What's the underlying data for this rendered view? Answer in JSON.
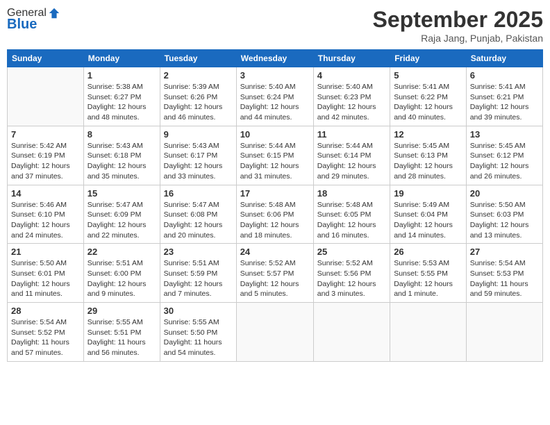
{
  "logo": {
    "general": "General",
    "blue": "Blue"
  },
  "header": {
    "month": "September 2025",
    "location": "Raja Jang, Punjab, Pakistan"
  },
  "weekdays": [
    "Sunday",
    "Monday",
    "Tuesday",
    "Wednesday",
    "Thursday",
    "Friday",
    "Saturday"
  ],
  "weeks": [
    [
      {
        "day": "",
        "sunrise": "",
        "sunset": "",
        "daylight": ""
      },
      {
        "day": "1",
        "sunrise": "Sunrise: 5:38 AM",
        "sunset": "Sunset: 6:27 PM",
        "daylight": "Daylight: 12 hours and 48 minutes."
      },
      {
        "day": "2",
        "sunrise": "Sunrise: 5:39 AM",
        "sunset": "Sunset: 6:26 PM",
        "daylight": "Daylight: 12 hours and 46 minutes."
      },
      {
        "day": "3",
        "sunrise": "Sunrise: 5:40 AM",
        "sunset": "Sunset: 6:24 PM",
        "daylight": "Daylight: 12 hours and 44 minutes."
      },
      {
        "day": "4",
        "sunrise": "Sunrise: 5:40 AM",
        "sunset": "Sunset: 6:23 PM",
        "daylight": "Daylight: 12 hours and 42 minutes."
      },
      {
        "day": "5",
        "sunrise": "Sunrise: 5:41 AM",
        "sunset": "Sunset: 6:22 PM",
        "daylight": "Daylight: 12 hours and 40 minutes."
      },
      {
        "day": "6",
        "sunrise": "Sunrise: 5:41 AM",
        "sunset": "Sunset: 6:21 PM",
        "daylight": "Daylight: 12 hours and 39 minutes."
      }
    ],
    [
      {
        "day": "7",
        "sunrise": "Sunrise: 5:42 AM",
        "sunset": "Sunset: 6:19 PM",
        "daylight": "Daylight: 12 hours and 37 minutes."
      },
      {
        "day": "8",
        "sunrise": "Sunrise: 5:43 AM",
        "sunset": "Sunset: 6:18 PM",
        "daylight": "Daylight: 12 hours and 35 minutes."
      },
      {
        "day": "9",
        "sunrise": "Sunrise: 5:43 AM",
        "sunset": "Sunset: 6:17 PM",
        "daylight": "Daylight: 12 hours and 33 minutes."
      },
      {
        "day": "10",
        "sunrise": "Sunrise: 5:44 AM",
        "sunset": "Sunset: 6:15 PM",
        "daylight": "Daylight: 12 hours and 31 minutes."
      },
      {
        "day": "11",
        "sunrise": "Sunrise: 5:44 AM",
        "sunset": "Sunset: 6:14 PM",
        "daylight": "Daylight: 12 hours and 29 minutes."
      },
      {
        "day": "12",
        "sunrise": "Sunrise: 5:45 AM",
        "sunset": "Sunset: 6:13 PM",
        "daylight": "Daylight: 12 hours and 28 minutes."
      },
      {
        "day": "13",
        "sunrise": "Sunrise: 5:45 AM",
        "sunset": "Sunset: 6:12 PM",
        "daylight": "Daylight: 12 hours and 26 minutes."
      }
    ],
    [
      {
        "day": "14",
        "sunrise": "Sunrise: 5:46 AM",
        "sunset": "Sunset: 6:10 PM",
        "daylight": "Daylight: 12 hours and 24 minutes."
      },
      {
        "day": "15",
        "sunrise": "Sunrise: 5:47 AM",
        "sunset": "Sunset: 6:09 PM",
        "daylight": "Daylight: 12 hours and 22 minutes."
      },
      {
        "day": "16",
        "sunrise": "Sunrise: 5:47 AM",
        "sunset": "Sunset: 6:08 PM",
        "daylight": "Daylight: 12 hours and 20 minutes."
      },
      {
        "day": "17",
        "sunrise": "Sunrise: 5:48 AM",
        "sunset": "Sunset: 6:06 PM",
        "daylight": "Daylight: 12 hours and 18 minutes."
      },
      {
        "day": "18",
        "sunrise": "Sunrise: 5:48 AM",
        "sunset": "Sunset: 6:05 PM",
        "daylight": "Daylight: 12 hours and 16 minutes."
      },
      {
        "day": "19",
        "sunrise": "Sunrise: 5:49 AM",
        "sunset": "Sunset: 6:04 PM",
        "daylight": "Daylight: 12 hours and 14 minutes."
      },
      {
        "day": "20",
        "sunrise": "Sunrise: 5:50 AM",
        "sunset": "Sunset: 6:03 PM",
        "daylight": "Daylight: 12 hours and 13 minutes."
      }
    ],
    [
      {
        "day": "21",
        "sunrise": "Sunrise: 5:50 AM",
        "sunset": "Sunset: 6:01 PM",
        "daylight": "Daylight: 12 hours and 11 minutes."
      },
      {
        "day": "22",
        "sunrise": "Sunrise: 5:51 AM",
        "sunset": "Sunset: 6:00 PM",
        "daylight": "Daylight: 12 hours and 9 minutes."
      },
      {
        "day": "23",
        "sunrise": "Sunrise: 5:51 AM",
        "sunset": "Sunset: 5:59 PM",
        "daylight": "Daylight: 12 hours and 7 minutes."
      },
      {
        "day": "24",
        "sunrise": "Sunrise: 5:52 AM",
        "sunset": "Sunset: 5:57 PM",
        "daylight": "Daylight: 12 hours and 5 minutes."
      },
      {
        "day": "25",
        "sunrise": "Sunrise: 5:52 AM",
        "sunset": "Sunset: 5:56 PM",
        "daylight": "Daylight: 12 hours and 3 minutes."
      },
      {
        "day": "26",
        "sunrise": "Sunrise: 5:53 AM",
        "sunset": "Sunset: 5:55 PM",
        "daylight": "Daylight: 12 hours and 1 minute."
      },
      {
        "day": "27",
        "sunrise": "Sunrise: 5:54 AM",
        "sunset": "Sunset: 5:53 PM",
        "daylight": "Daylight: 11 hours and 59 minutes."
      }
    ],
    [
      {
        "day": "28",
        "sunrise": "Sunrise: 5:54 AM",
        "sunset": "Sunset: 5:52 PM",
        "daylight": "Daylight: 11 hours and 57 minutes."
      },
      {
        "day": "29",
        "sunrise": "Sunrise: 5:55 AM",
        "sunset": "Sunset: 5:51 PM",
        "daylight": "Daylight: 11 hours and 56 minutes."
      },
      {
        "day": "30",
        "sunrise": "Sunrise: 5:55 AM",
        "sunset": "Sunset: 5:50 PM",
        "daylight": "Daylight: 11 hours and 54 minutes."
      },
      {
        "day": "",
        "sunrise": "",
        "sunset": "",
        "daylight": ""
      },
      {
        "day": "",
        "sunrise": "",
        "sunset": "",
        "daylight": ""
      },
      {
        "day": "",
        "sunrise": "",
        "sunset": "",
        "daylight": ""
      },
      {
        "day": "",
        "sunrise": "",
        "sunset": "",
        "daylight": ""
      }
    ]
  ]
}
